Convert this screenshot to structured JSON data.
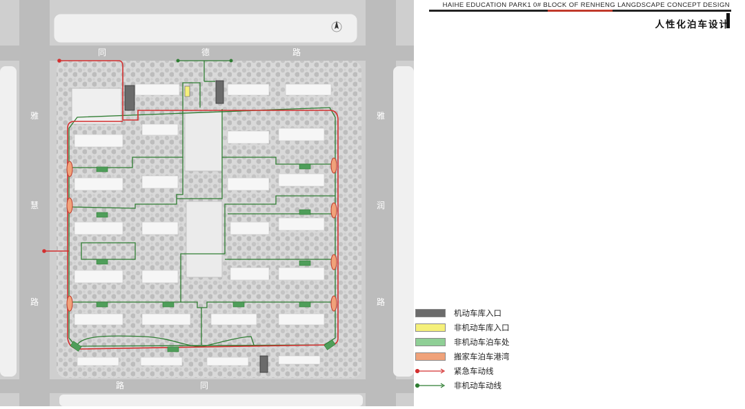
{
  "header": {
    "subtitle": "HAIHE  EDUCATION  PARK1 0# BLOCK OF RENHENG  LANGDSCAPE  CONCEPT DESIGN",
    "title": "人性化泊车设计",
    "accent_color": "#c0392b"
  },
  "map": {
    "road_labels": {
      "north_1": "同",
      "north_2": "德",
      "north_3": "路",
      "west_1": "雅",
      "west_2": "慧",
      "west_3": "路",
      "east_1": "雅",
      "east_2": "润",
      "east_3": "路",
      "south_1": "路",
      "south_2": "同"
    },
    "north_arrow_icon": "north-arrow-icon"
  },
  "legend": {
    "items": [
      {
        "label": "机动车库入口",
        "color": "#6b6b6b",
        "kind": "swatch"
      },
      {
        "label": "非机动车库入口",
        "color": "#f5f07a",
        "kind": "swatch"
      },
      {
        "label": "非机动车泊车处",
        "color": "#8fcf96",
        "kind": "swatch"
      },
      {
        "label": "搬家车泊车港湾",
        "color": "#f0a27a",
        "kind": "swatch"
      },
      {
        "label": "紧急车动线",
        "color": "#d32f2f",
        "kind": "line"
      },
      {
        "label": "非机动车动线",
        "color": "#2e7d32",
        "kind": "line"
      }
    ]
  }
}
